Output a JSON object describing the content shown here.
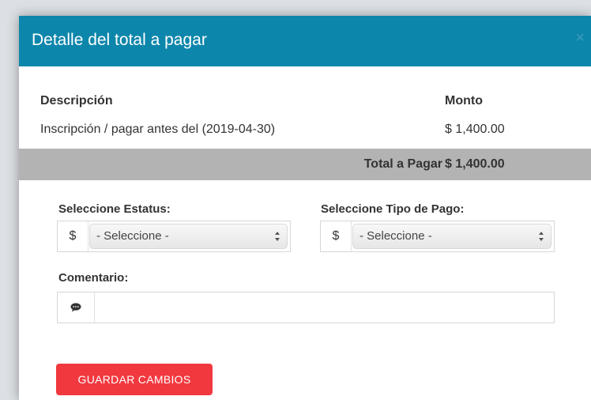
{
  "modal": {
    "title": "Detalle del total a pagar",
    "close_symbol": "×",
    "header_color": "#0d86ab"
  },
  "table": {
    "headers": {
      "description": "Descripción",
      "amount": "Monto"
    },
    "items": [
      {
        "description": "Inscripción / pagar antes del (2019-04-30)",
        "amount": "$ 1,400.00"
      }
    ],
    "total_label": "Total a Pagar",
    "total_amount": "$ 1,400.00"
  },
  "form": {
    "status": {
      "label": "Seleccione Estatus:",
      "addon": "$",
      "selected": "- Seleccione -"
    },
    "payment_type": {
      "label": "Seleccione Tipo de Pago:",
      "addon": "$",
      "selected": "- Seleccione -"
    },
    "comment": {
      "label": "Comentario:",
      "icon": "comment-icon",
      "value": ""
    },
    "save_label": "GUARDAR CAMBIOS",
    "save_color": "#f2383f"
  }
}
